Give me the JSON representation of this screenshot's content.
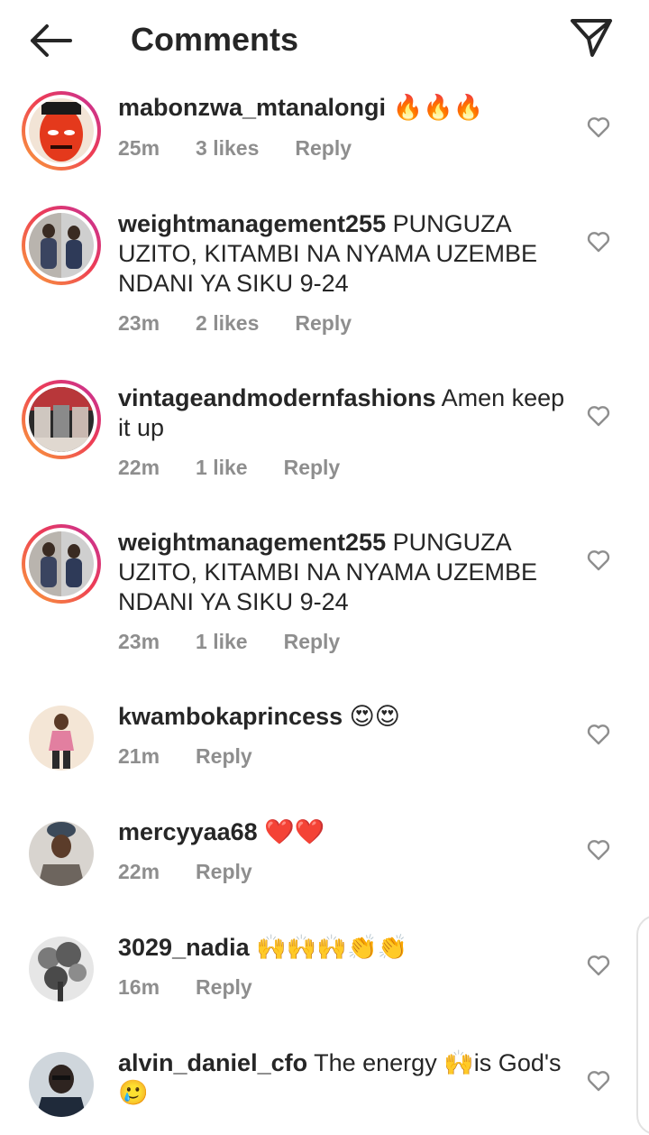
{
  "header": {
    "title": "Comments",
    "back_icon": "arrow-left-icon",
    "send_icon": "paper-plane-icon"
  },
  "colors": {
    "text": "#262626",
    "meta": "#8e8e8e",
    "story_ring": [
      "#f9a13a",
      "#ee3d54",
      "#c22f9e"
    ]
  },
  "comments": [
    {
      "username": "mabonzwa_mtanalongi",
      "text": "🔥🔥🔥",
      "time": "25m",
      "likes": "3 likes",
      "reply": "Reply",
      "story_ring": true
    },
    {
      "username": "weightmanagement255",
      "text": "PUNGUZA UZITO, KITAMBI NA NYAMA UZEMBE NDANI YA SIKU 9-24",
      "time": "23m",
      "likes": "2 likes",
      "reply": "Reply",
      "story_ring": true
    },
    {
      "username": "vintageandmodernfashions",
      "text": "Amen keep it up",
      "time": "22m",
      "likes": "1 like",
      "reply": "Reply",
      "story_ring": true
    },
    {
      "username": "weightmanagement255",
      "text": "PUNGUZA UZITO, KITAMBI NA NYAMA UZEMBE NDANI YA SIKU 9-24",
      "time": "23m",
      "likes": "1 like",
      "reply": "Reply",
      "story_ring": true
    },
    {
      "username": "kwambokaprincess",
      "text": "😍😍",
      "time": "21m",
      "likes": "",
      "reply": "Reply",
      "story_ring": false
    },
    {
      "username": "mercyyaa68",
      "text": "❤️❤️",
      "time": "22m",
      "likes": "",
      "reply": "Reply",
      "story_ring": false
    },
    {
      "username": "3029_nadia",
      "text": "🙌🙌🙌👏👏",
      "time": "16m",
      "likes": "",
      "reply": "Reply",
      "story_ring": false
    },
    {
      "username": "alvin_daniel_cfo",
      "text": "The energy 🙌is God's 🥲",
      "time": "",
      "likes": "",
      "reply": "",
      "story_ring": false
    }
  ]
}
